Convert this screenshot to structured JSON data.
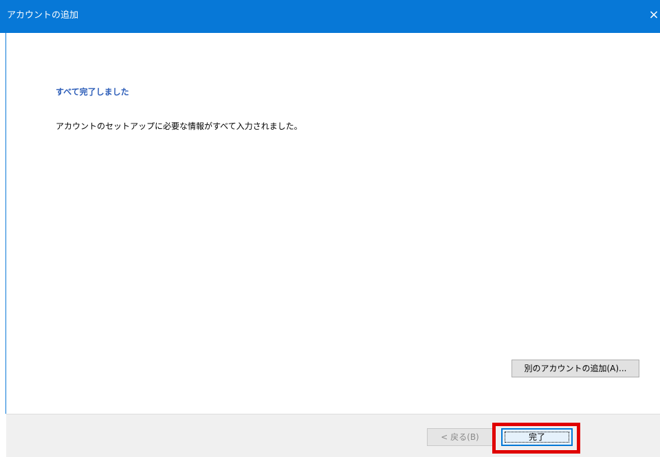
{
  "window": {
    "title": "アカウントの追加",
    "close_glyph": "×",
    "accent_color": "#0778d7"
  },
  "content": {
    "heading": "すべて完了しました",
    "message": "アカウントのセットアップに必要な情報がすべて入力されました。",
    "add_another_account_label": "別のアカウントの追加(A)..."
  },
  "footer": {
    "back_label": "< 戻る(B)",
    "finish_label": "完了",
    "highlight_color": "#e00000"
  }
}
